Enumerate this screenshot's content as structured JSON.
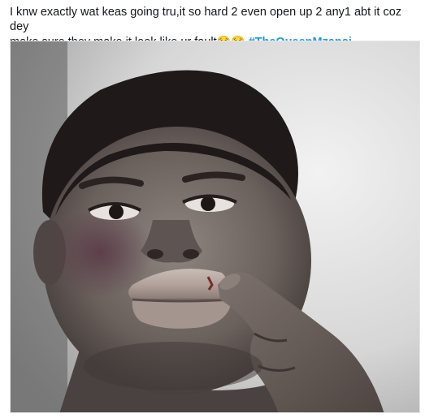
{
  "tweet": {
    "text_line1": "I knw exactly wat keas going tru,it so hard 2 even open up 2 any1 abt it coz dey",
    "text_line2": "make sure they make it look like ur fault",
    "emojis": "😢😢",
    "hashtag": "#TheQueenMzansi",
    "hashtag_color": "#1b95e0",
    "text_color": "#14171a"
  },
  "media": {
    "icon": "photo-image"
  }
}
